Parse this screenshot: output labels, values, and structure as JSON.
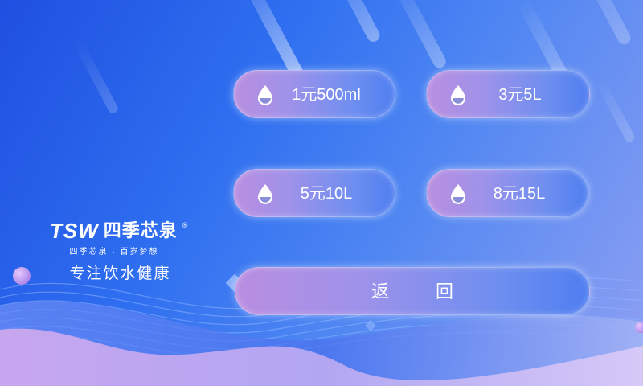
{
  "brand": {
    "logo_latin": "TSW",
    "logo_cn": "四季芯泉",
    "logo_reg": "®",
    "slogan": "四季芯泉 · 百岁梦想",
    "tagline": "专注饮水健康"
  },
  "options": [
    {
      "label": "1元500ml",
      "icon": "water-drop-icon"
    },
    {
      "label": "3元5L",
      "icon": "water-drop-icon"
    },
    {
      "label": "5元10L",
      "icon": "water-drop-icon"
    },
    {
      "label": "8元15L",
      "icon": "water-drop-icon"
    }
  ],
  "back_label": "返回",
  "colors": {
    "bg_start": "#1f4fe0",
    "bg_end": "#8fa0f2",
    "pill_left": "#b98ee0",
    "pill_right": "#4f7ef0",
    "text": "#ffffff"
  }
}
